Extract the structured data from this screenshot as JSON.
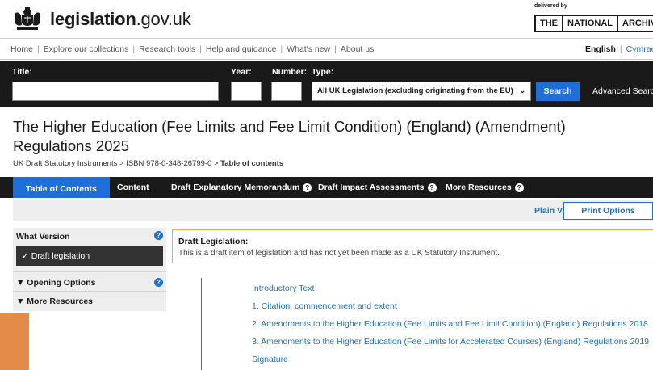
{
  "header": {
    "site_name_bold": "legislation",
    "site_name_rest": ".gov.uk",
    "delivered_by": "delivered by",
    "tna": [
      "THE",
      "NATIONAL",
      "ARCHIVES"
    ]
  },
  "nav": {
    "links": [
      "Home",
      "Explore our collections",
      "Research tools",
      "Help and guidance",
      "What's new",
      "About us"
    ],
    "lang_en": "English",
    "lang_cy": "Cymraeg"
  },
  "search": {
    "title_label": "Title:",
    "year_label": "Year:",
    "number_label": "Number:",
    "type_label": "Type:",
    "type_value": "All UK Legislation (excluding originating from the EU)",
    "search_button": "Search",
    "advanced": "Advanced Search"
  },
  "document": {
    "title": "The Higher Education (Fee Limits and Fee Limit Condition) (England) (Amendment) Regulations 2025",
    "breadcrumb": [
      "UK Draft Statutory Instruments",
      "ISBN 978-0-348-26799-0",
      "Table of contents"
    ]
  },
  "tabs": [
    {
      "label": "Table of Contents",
      "active": true,
      "help": false
    },
    {
      "label": "Content",
      "active": false,
      "help": false
    },
    {
      "label": "Draft Explanatory Memorandum",
      "active": false,
      "help": true
    },
    {
      "label": "Draft Impact Assessments",
      "active": false,
      "help": true
    },
    {
      "label": "More Resources",
      "active": false,
      "help": true
    }
  ],
  "toolbar": {
    "plain_view": "Plain View",
    "print_options": "Print Options"
  },
  "sidebar": {
    "what_version": "What Version",
    "draft_legislation": "✓ Draft legislation",
    "opening_options": "▼ Opening Options",
    "more_resources": "▼ More Resources"
  },
  "notice": {
    "heading": "Draft Legislation:",
    "text": "This is a draft item of legislation and has not yet been made as a UK Statutory Instrument."
  },
  "toc": [
    "Introductory Text",
    "1. Citation, commencement and extent",
    "2. Amendments to the Higher Education (Fee Limits and Fee Limit Condition) (England) Regulations 2018",
    "3. Amendments to the Higher Education (Fee Limits for Accelerated Courses) (England) Regulations 2019",
    "Signature"
  ],
  "colors": {
    "accent": "#1e6fd9",
    "link": "#1a73b8",
    "dark_band": "#1a1a1a",
    "notice_border": "#f0a944"
  }
}
